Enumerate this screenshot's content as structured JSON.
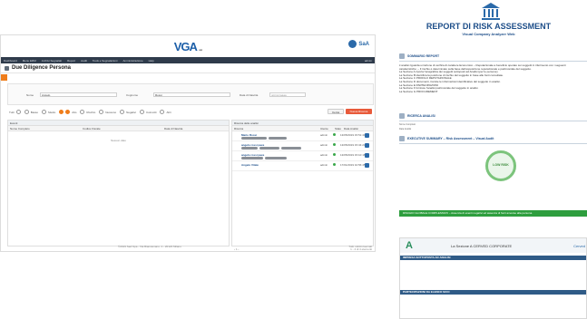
{
  "app": {
    "logo": "VGA",
    "logo_tag": "analyzer",
    "brand": "SaA",
    "menu": [
      "Dashboard",
      "Menu ERM",
      "Archivi Segnalati",
      "Report",
      "Audit",
      "Tools e Segnalazioni",
      "Amministrazione",
      "Help"
    ],
    "user": "admin",
    "page_title": "Due Diligence Persona",
    "filters": {
      "nome_label": "Nome",
      "nome_value": "Angelo",
      "cognome_label": "Cognome",
      "cognome_value": "Rossi",
      "data_label": "Data di Nascita",
      "data_placeholder": "gg/mm/aaaa"
    },
    "radios": [
      "Tutti",
      "Basso",
      "Medio",
      "Alto",
      "Rischio",
      "Nessuno",
      "Negativi",
      "Coinvolti",
      "Altri"
    ],
    "search_btn": "Cerca",
    "new_btn": "Nuova Ricerca",
    "left_pane": {
      "header": "Eventi",
      "columns": [
        "Nome Completo",
        "Codice Fiscale",
        "Data di Nascita"
      ],
      "empty": "Nessun dato"
    },
    "right_pane": {
      "header": "Ricerca delle analisi",
      "columns": [
        "Ricerca",
        "Utente",
        "Stato",
        "Data Analisi"
      ],
      "rows": [
        {
          "name": "Mario Rossi",
          "user": "admin",
          "date": "13/05/2019 15:51:40"
        },
        {
          "name": "angelo rossi pace",
          "user": "admin",
          "date": "13/05/2019 15:34:24"
        },
        {
          "name": "angelo rossi pace",
          "user": "admin",
          "date": "13/05/2019 15:10:18"
        },
        {
          "name": "Angelo Vitale",
          "user": "admin",
          "date": "17/01/2019 10:56:45"
        }
      ],
      "pager": "1 - 4 di 4 elementi"
    },
    "footer_left": "©2019 SaA Spa - Via Biancamano, 1 - 20123 Milano",
    "footer_right": "Tutti i diritti riservati"
  },
  "report": {
    "title": "REPORT DI RISK ASSESSMENT",
    "subtitle": "Visual Company Analyzer Web",
    "sections": {
      "summary": "SOMMARIO REPORT",
      "search": "RICERCA ANALISI",
      "executive": "EXECUTIVE SUMMARY – Risk Assessment – Visual Audit"
    },
    "summary_lines": [
      "L'analisi riguarda un'azione di verifica di carattere Economico – Reputazionale a beneficio operato sui soggetti in riferimento con i seguenti",
      "caratteristiche: – Il rischio è determinato sulla base dell'esposizione reputazionale e patrimoniale del soggetto.",
      "La Sezione A riporta l'anagrafica dei soggetti sottoposti ad Analisi (per le persone).",
      "La Sezione B identifica la posizione di rischio del soggetto in base alle fonti consultate.",
      "La Sezione C PROFILO REPUTAZIONALE",
      "La Sezione D documenti, tramite le informazioni identificative del soggetto in analisi.",
      "La Sezione E PARTECIPAZIONI",
      "La Sezione F fornisce l'analisi patrimoniale del soggetto in analisi.",
      "La Sezione G PROCUREMENT"
    ],
    "search_fields": {
      "name": "Nome Completo",
      "date": "Data Analisi"
    },
    "gauge_label": "LOW RISK",
    "green_bar": "RISCHIO GLOBALE COMPLESSIVO – Assenza di eventi negativi ed assenza di fonti avverse alla persona",
    "doc2": {
      "letter": "A",
      "title": "La Sezione A CERVED CORPORATE",
      "right": "Cerved",
      "band1": "IMPRESA SOTTOPOSTA AD ANALISI",
      "band2": "PARTECIPAZIONI DA ELENCO SOCI"
    }
  }
}
